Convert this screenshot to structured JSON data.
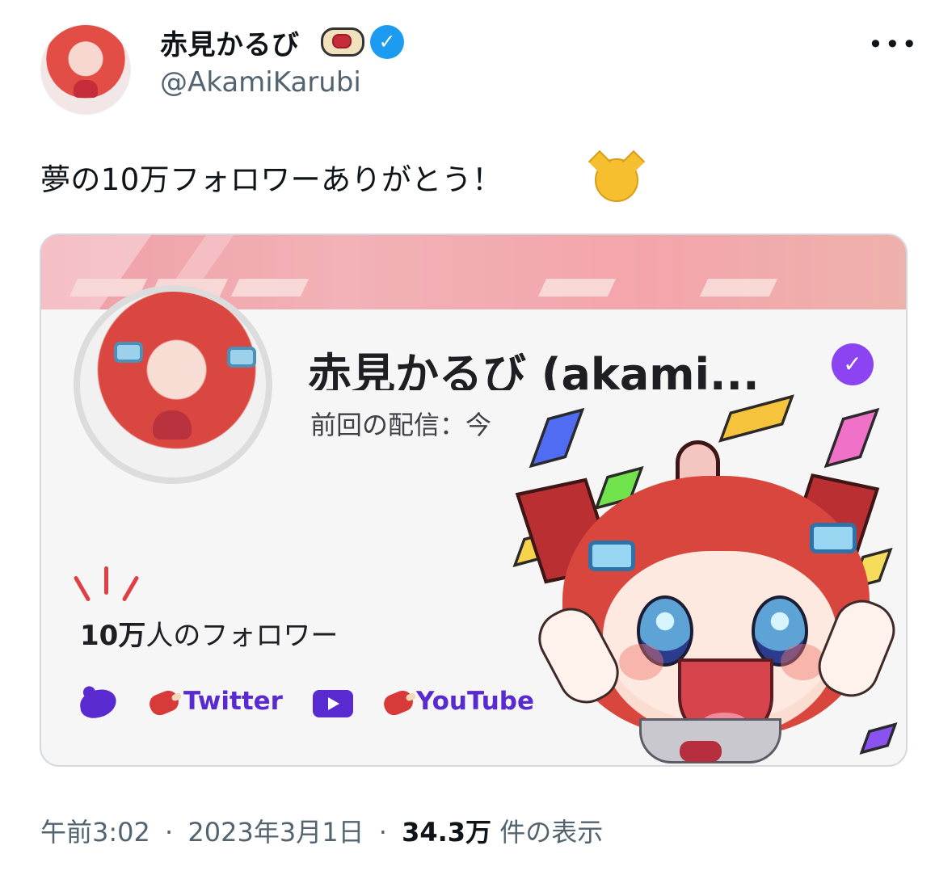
{
  "tweet": {
    "author": {
      "display_name": "赤見かるび",
      "handle": "@AkamiKarubi",
      "verified": true
    },
    "text": "夢の10万フォロワーありがとう！",
    "emoji": "laughing-cat",
    "timestamp": "午前3:02",
    "date": "2023年3月1日",
    "views": "34.3万",
    "views_label": "件の表示"
  },
  "card": {
    "channel_name": "赤見かるび (akami...",
    "last_stream": "前回の配信：今",
    "followers_number": "10万",
    "followers_label": "人のフォロワー",
    "links": [
      {
        "label": "Twitter",
        "icon": "meat-icon"
      },
      {
        "label": "YouTube",
        "icon": "meat-icon"
      }
    ],
    "icons": [
      "twitter-bird-icon",
      "youtube-icon",
      "verified-icon"
    ]
  },
  "colors": {
    "twitter_blue": "#1d9bf0",
    "purple": "#5a2ad1",
    "card_verified": "#8c43f2",
    "banner_pink": "#f2b2b7",
    "text_gray": "#536471"
  }
}
